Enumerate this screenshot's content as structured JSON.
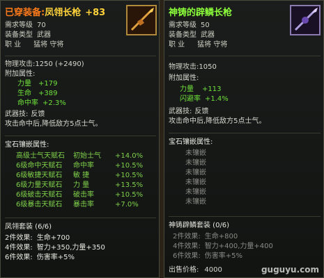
{
  "left": {
    "title_prefix": "已穿装备:",
    "title_name": "凤翎长枪",
    "title_plus": "+83",
    "icon": "spear-icon",
    "req_level_label": "需求等级",
    "req_level": "70",
    "type_label": "装备类型",
    "type": "武器",
    "job_label": "职 业",
    "jobs": "猛将 守将",
    "attack_label": "物理攻击",
    "attack": ":1250 (+2490)",
    "attach_label": "附加属性:",
    "attrs": [
      {
        "name": "力量",
        "value": "+179"
      },
      {
        "name": "生命",
        "value": "+389"
      },
      {
        "name": "命中率",
        "value": "+2.3%"
      }
    ],
    "skill_label": "武器技:",
    "skill": "反馈",
    "skill_desc": "攻击命中后,降低敌方5点士气。",
    "gem_title": "宝石镶嵌属性:",
    "gems": [
      {
        "stone": "高级士气天赋石",
        "attr": "初始士气",
        "value": "+14.0%"
      },
      {
        "stone": "6级命中天赋石",
        "attr": "命中率",
        "value": "+10.5%"
      },
      {
        "stone": "6级敏捷天赋石",
        "attr": "敏 捷",
        "value": "+10.5%"
      },
      {
        "stone": "6级力量天赋石",
        "attr": "力 量",
        "value": "+13.5%"
      },
      {
        "stone": "6级破击天赋石",
        "attr": "破击率",
        "value": "+10.5%"
      },
      {
        "stone": "6级暴击天赋石",
        "attr": "暴击率",
        "value": "+7.0%"
      }
    ],
    "set_title": "凤翎套装 (6/6)",
    "set_effects": [
      {
        "label": "2件效果:",
        "text": "生命+700"
      },
      {
        "label": "4件效果:",
        "text": "智力+350,力量+350"
      },
      {
        "label": "6件效果:",
        "text": "伤害率+5%"
      }
    ]
  },
  "right": {
    "title_name": "神铸的辟鳞长枪",
    "icon": "spear-icon",
    "req_level_label": "需求等级",
    "req_level": "50",
    "type_label": "装备类型",
    "type": "武器",
    "job_label": "职 业",
    "jobs": "猛将 守将",
    "attack_label": "物理攻击",
    "attack": ":1050",
    "attach_label": "附加属性:",
    "attrs": [
      {
        "name": "力量",
        "value": "+113"
      },
      {
        "name": "闪避率",
        "value": "+1.4%"
      }
    ],
    "skill_label": "武器技:",
    "skill": "反馈",
    "skill_desc": "攻击命中后,降低敌方5点士气。",
    "gem_title": "宝石镶嵌属性:",
    "gems": [
      "未镶嵌",
      "未镶嵌",
      "未镶嵌",
      "未镶嵌",
      "未镶嵌",
      "未镶嵌"
    ],
    "set_title": "神铸辟鳞套装 (0/6)",
    "set_effects": [
      {
        "label": "2件效果:",
        "text": "生命+800"
      },
      {
        "label": "4件效果:",
        "text": "智力+400,力量+400"
      },
      {
        "label": "6件效果:",
        "text": "伤害率+5%"
      }
    ],
    "price_label": "出售价格:",
    "price": "4000"
  },
  "watermark": "guguyu.com",
  "colors": {
    "orange": "#ff7a1a",
    "gold": "#ffd23a",
    "green_title": "#8cff3a",
    "attr_green": "#6fe03a"
  }
}
